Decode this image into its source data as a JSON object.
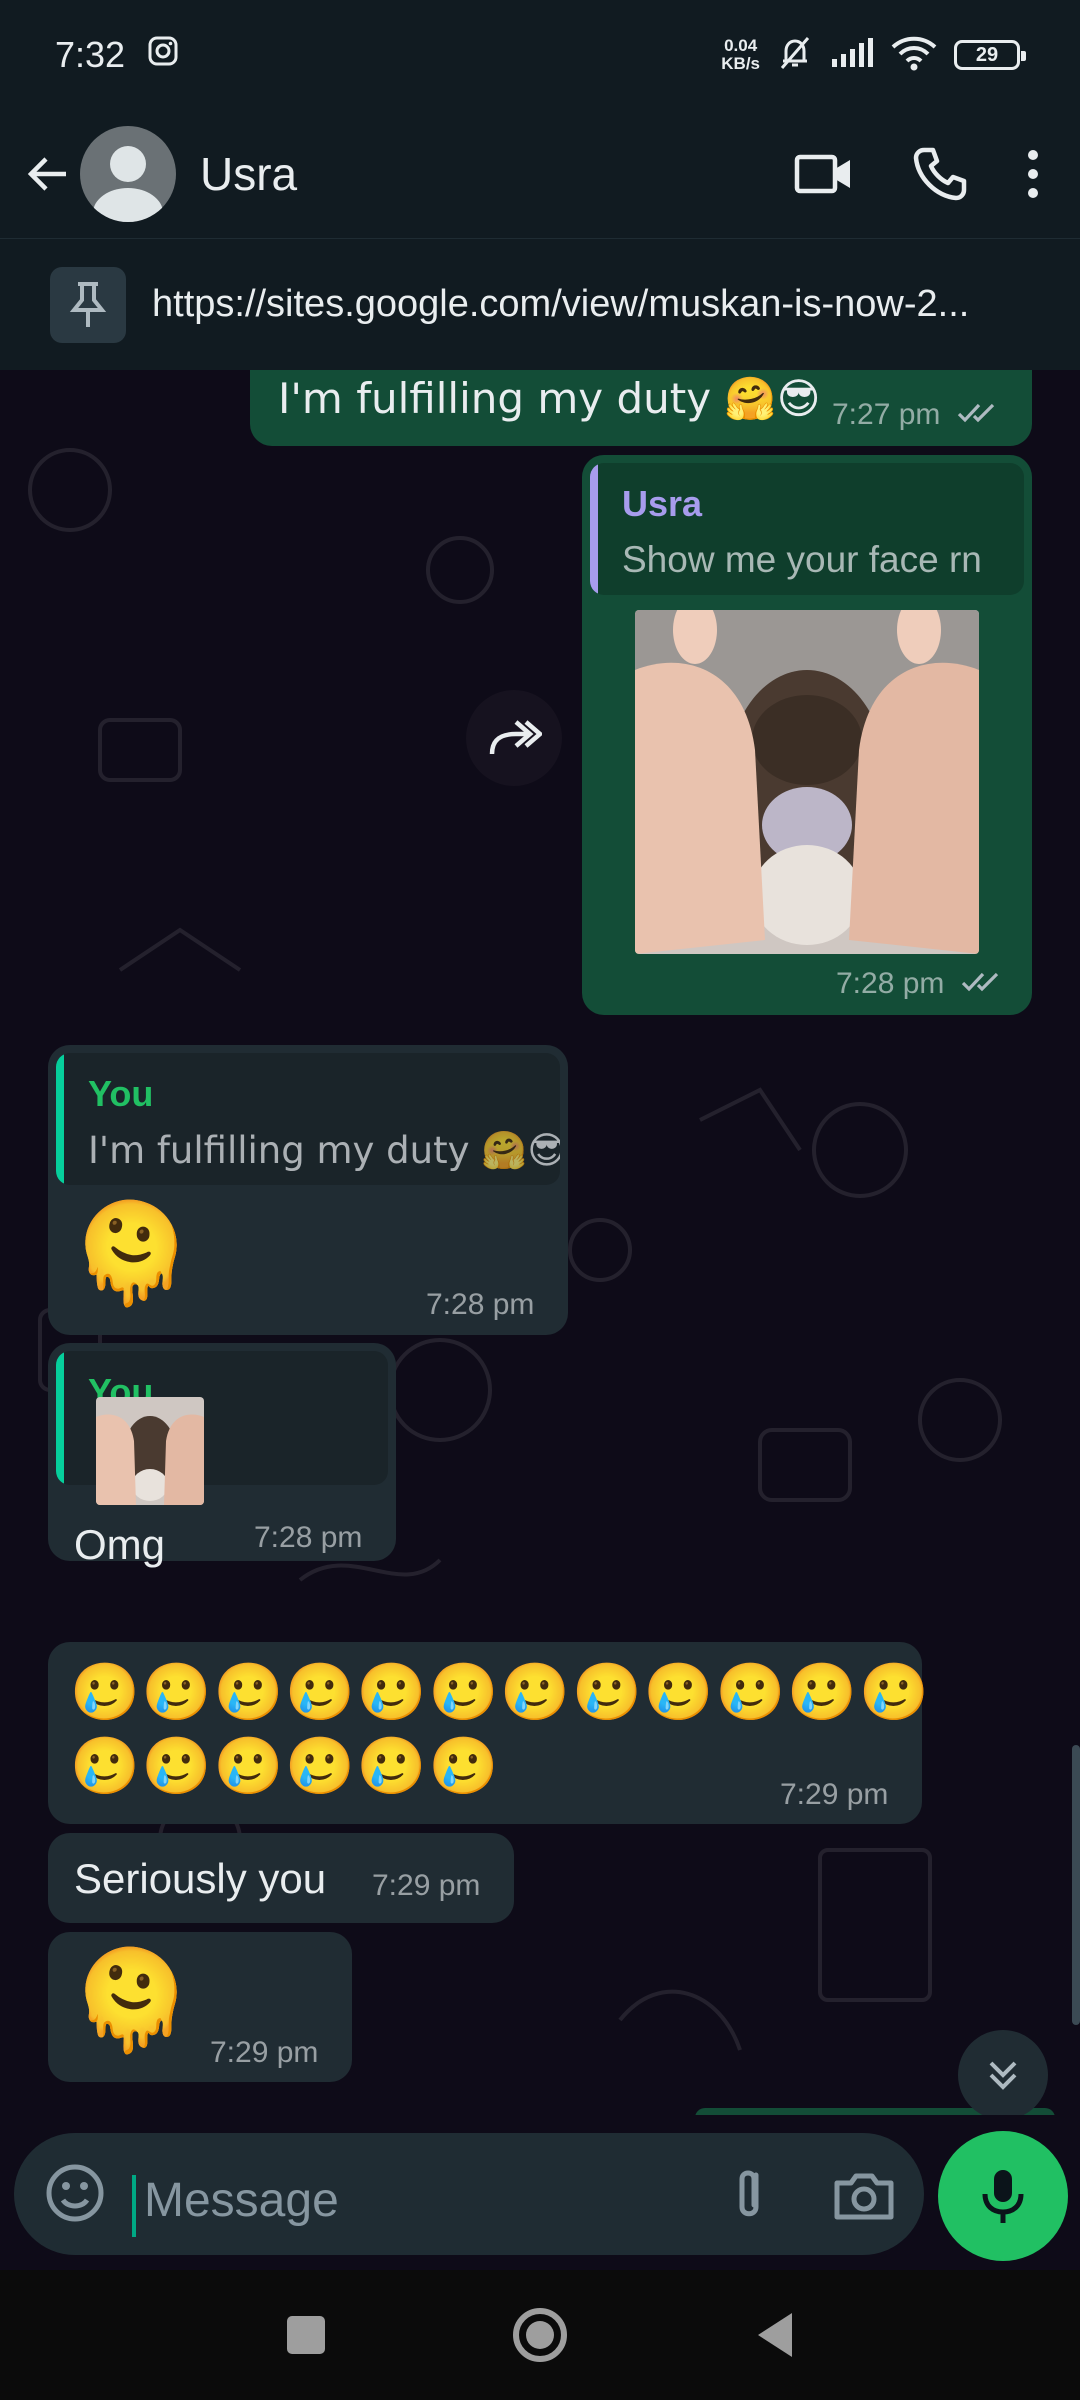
{
  "status_bar": {
    "time": "7:32",
    "net_speed_value": "0.04",
    "net_speed_unit": "KB/s",
    "battery": "29"
  },
  "header": {
    "contact_name": "Usra"
  },
  "pinned": {
    "link": "https://sites.google.com/view/muskan-is-now-2..."
  },
  "messages": [
    {
      "type": "outgoing",
      "text": "I'm fulfilling my duty 🤗😎",
      "time": "7:27 pm"
    },
    {
      "type": "outgoing",
      "quote_author": "Usra",
      "quote_text": "Show me your face rn",
      "time": "7:28 pm"
    },
    {
      "type": "incoming",
      "quote_author": "You",
      "quote_text": "I'm fulfilling my duty 🤗😎",
      "emoji": "🫠",
      "time": "7:28 pm"
    },
    {
      "type": "incoming",
      "quote_author": "You",
      "text": "Omg",
      "time": "7:28 pm"
    },
    {
      "type": "incoming",
      "emoji_line_1": "🥲🥲🥲🥲🥲🥲🥲🥲🥲🥲🥲🥲",
      "emoji_line_2": "🥲🥲🥲🥲🥲🥲",
      "time": "7:29 pm"
    },
    {
      "type": "incoming",
      "text": "Seriously you",
      "time": "7:29 pm"
    },
    {
      "type": "incoming",
      "emoji": "🫠",
      "time": "7:29 pm"
    }
  ],
  "input": {
    "placeholder": "Message"
  },
  "colors": {
    "outgoing_bubble": "#134d37",
    "incoming_bubble": "#202c33",
    "accent_green": "#21c063",
    "quote_purple": "#a79ced"
  }
}
